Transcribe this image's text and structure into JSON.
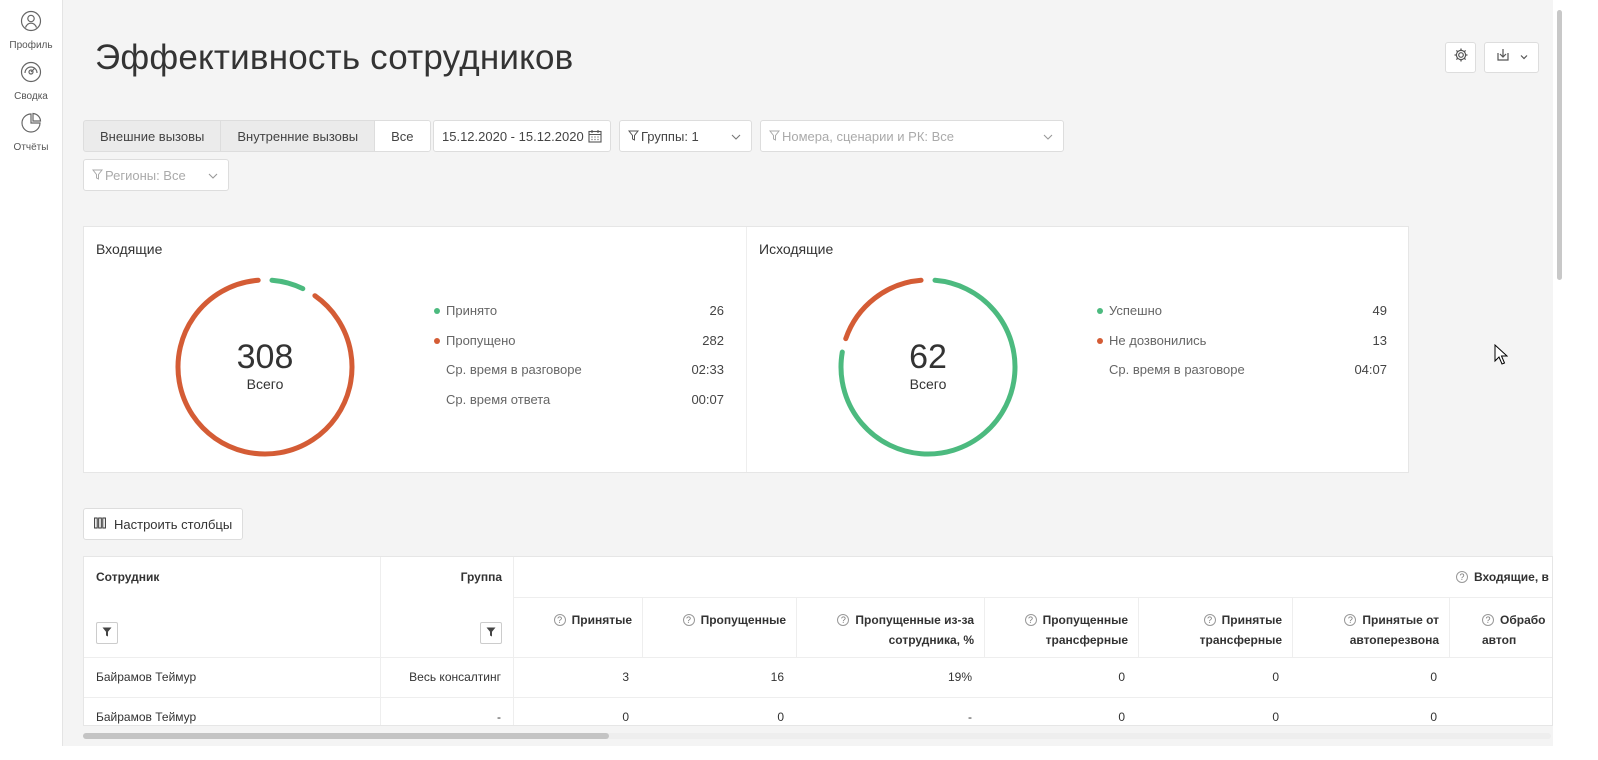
{
  "sidebar": {
    "items": [
      {
        "label": "Профиль",
        "icon": "user-icon"
      },
      {
        "label": "Сводка",
        "icon": "dashboard-icon"
      },
      {
        "label": "Отчёты",
        "icon": "pie-chart-icon"
      }
    ]
  },
  "page": {
    "title": "Эффективность сотрудников"
  },
  "filters": {
    "call_types": [
      "Внешние вызовы",
      "Внутренние вызовы",
      "Все"
    ],
    "selected_call_type": "Все",
    "date_range": "15.12.2020 - 15.12.2020",
    "groups": "Группы: 1",
    "numbers_placeholder": "Номера, сценарии и РК: Все",
    "regions_placeholder": "Регионы: Все"
  },
  "colors": {
    "success": "#4cba7f",
    "missed": "#d45c35"
  },
  "incoming": {
    "title": "Входящие",
    "total": "308",
    "total_label": "Всего",
    "accepted_share": 0.0844,
    "legend": [
      {
        "label": "Принято",
        "value": "26",
        "color": "#4cba7f"
      },
      {
        "label": "Пропущено",
        "value": "282",
        "color": "#d45c35"
      },
      {
        "label": "Ср. время в разговоре",
        "value": "02:33",
        "color": ""
      },
      {
        "label": "Ср. время ответа",
        "value": "00:07",
        "color": ""
      }
    ]
  },
  "outgoing": {
    "title": "Исходящие",
    "total": "62",
    "total_label": "Всего",
    "success_share": 0.79,
    "legend": [
      {
        "label": "Успешно",
        "value": "49",
        "color": "#4cba7f"
      },
      {
        "label": "Не дозвонились",
        "value": "13",
        "color": "#d45c35"
      },
      {
        "label": "Ср. время в разговоре",
        "value": "04:07",
        "color": ""
      }
    ]
  },
  "table": {
    "configure_label": "Настроить столбцы",
    "col_employee": "Сотрудник",
    "col_group": "Группа",
    "group_header": "Входящие, в",
    "subcolumns": [
      "Принятые",
      "Пропущенные",
      "Пропущенные из-за сотрудника, %",
      "Пропущенные трансферные",
      "Принятые трансферные",
      "Принятые от автоперезвона",
      "Обрабо автоп"
    ],
    "rows": [
      {
        "employee": "Байрамов Теймур",
        "group": "Весь консалтинг",
        "values": [
          "3",
          "16",
          "19%",
          "0",
          "0",
          "0"
        ]
      },
      {
        "employee": "Байрамов Теймур",
        "group": "-",
        "values": [
          "0",
          "0",
          "-",
          "0",
          "0",
          "0"
        ]
      }
    ]
  }
}
